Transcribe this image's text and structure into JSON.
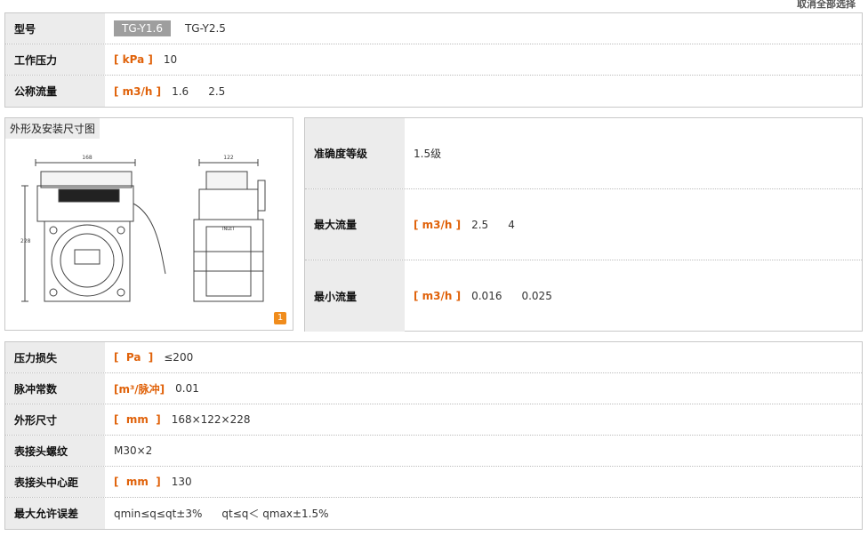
{
  "header": {
    "top_link": "取消全部选择"
  },
  "spec_top": {
    "model_label": "型号",
    "models": [
      "TG-Y1.6",
      "TG-Y2.5"
    ],
    "pressure_label": "工作压力",
    "pressure_unit": "[ kPa ]",
    "pressure_value": "10",
    "flow_label": "公称流量",
    "flow_unit": "[ m3/h ]",
    "flow_values": [
      "1.6",
      "2.5"
    ]
  },
  "diagram": {
    "title": "外形及安装尺寸图",
    "badge": "1",
    "dim_width": "168",
    "dim_depth": "122",
    "dim_height": "228",
    "inlet_label": "INLET"
  },
  "spec_mid": {
    "accuracy_label": "准确度等级",
    "accuracy_value": "1.5级",
    "max_flow_label": "最大流量",
    "max_flow_unit": "[ m3/h ]",
    "max_flow_values": [
      "2.5",
      "4"
    ],
    "min_flow_label": "最小流量",
    "min_flow_unit": "[ m3/h ]",
    "min_flow_values": [
      "0.016",
      "0.025"
    ]
  },
  "spec_bottom": {
    "pressure_loss_label": "压力损失",
    "pressure_loss_unit": "[  Pa  ]",
    "pressure_loss_value": "≤200",
    "pulse_label": "脉冲常数",
    "pulse_unit": "[m³/脉冲]",
    "pulse_value": "0.01",
    "size_label": "外形尺寸",
    "size_unit": "[  mm  ]",
    "size_value": "168×122×228",
    "thread_label": "表接头螺纹",
    "thread_value": "M30×2",
    "center_label": "表接头中心距",
    "center_unit": "[  mm  ]",
    "center_value": "130",
    "error_label": "最大允许误差",
    "error_values": [
      "qmin≤q≤qt±3%",
      "qt≤q＜ qmax±1.5%"
    ]
  }
}
